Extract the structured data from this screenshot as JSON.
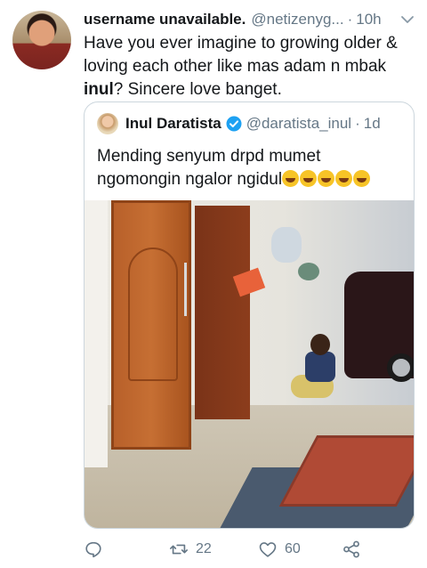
{
  "tweet": {
    "display_name": "username unavailable.",
    "handle": "@netizenyg...",
    "separator": "·",
    "time": "10h",
    "text_before": "Have you ever imagine to growing older & loving each other like mas adam n mbak ",
    "text_bold": "inul",
    "text_after": "? Sincere love banget."
  },
  "quoted": {
    "display_name": "Inul Daratista",
    "handle": "@daratista_inul",
    "separator": "·",
    "time": "1d",
    "text": "Mending senyum drpd mumet ngomongin ngalor ngidul",
    "emoji_count": 5
  },
  "actions": {
    "reply_count": "",
    "retweet_count": "22",
    "like_count": "60"
  },
  "icons": {
    "more": "chevron-down-icon",
    "verified": "verified-badge-icon",
    "reply": "reply-icon",
    "retweet": "retweet-icon",
    "like": "heart-icon",
    "share": "share-icon"
  },
  "colors": {
    "text": "#14171a",
    "muted": "#657786",
    "verified": "#1da1f2",
    "border": "#ccd6dd"
  }
}
